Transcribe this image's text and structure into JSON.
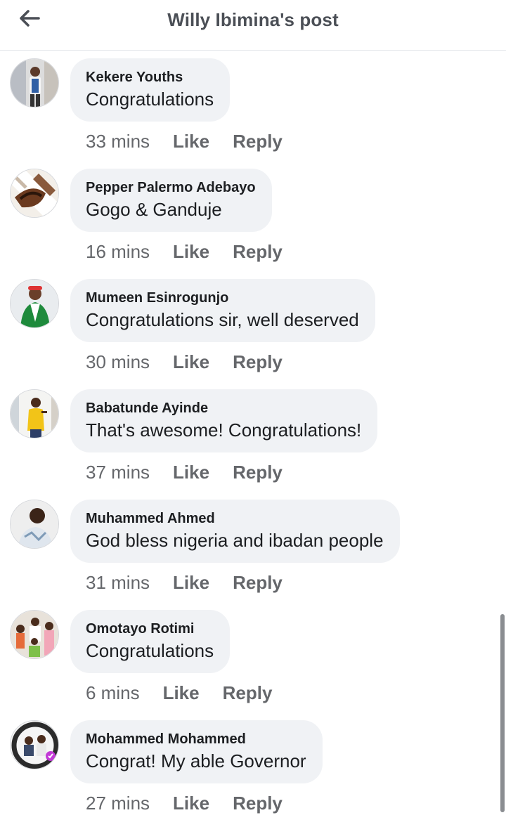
{
  "header": {
    "title": "Willy Ibimina's post",
    "back_icon": "arrow-left-icon"
  },
  "comments": [
    {
      "author": "Kekere Youths",
      "text": "Congratulations",
      "time": "33 mins",
      "like": "Like",
      "reply": "Reply"
    },
    {
      "author": "Pepper Palermo Adebayo",
      "text": "Gogo & Ganduje",
      "time": "16 mins",
      "like": "Like",
      "reply": "Reply"
    },
    {
      "author": "Mumeen Esinrogunjo",
      "text": "Congratulations sir, well deserved",
      "time": "30 mins",
      "like": "Like",
      "reply": "Reply"
    },
    {
      "author": "Babatunde Ayinde",
      "text": "That's awesome! Congratulations!",
      "time": "37 mins",
      "like": "Like",
      "reply": "Reply"
    },
    {
      "author": "Muhammed Ahmed",
      "text": "God bless nigeria and ibadan people",
      "time": "31 mins",
      "like": "Like",
      "reply": "Reply"
    },
    {
      "author": "Omotayo Rotimi",
      "text": "Congratulations",
      "time": "6 mins",
      "like": "Like",
      "reply": "Reply"
    },
    {
      "author": "Mohammed Mohammed",
      "text": "Congrat! My able Governor",
      "time": "27 mins",
      "like": "Like",
      "reply": "Reply"
    }
  ],
  "colors": {
    "bubble": "#f0f2f5",
    "meta_text": "#65676b",
    "primary_text": "#1c1e21"
  }
}
